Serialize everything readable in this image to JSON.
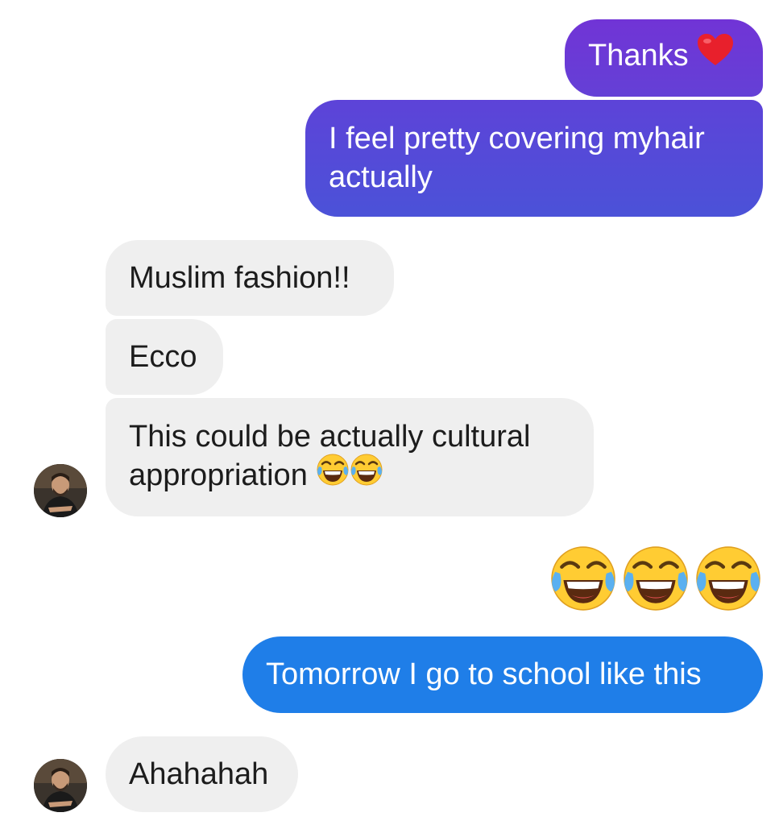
{
  "messages": {
    "m1": {
      "sender": "me",
      "text": "Thanks"
    },
    "m2": {
      "sender": "me",
      "text": "I feel pretty covering myhair actually",
      "line1": "I feel pretty covering myhair",
      "line2": "actually"
    },
    "m3": {
      "sender": "them",
      "text": "Muslim fashion!!"
    },
    "m4": {
      "sender": "them",
      "text": "Ecco"
    },
    "m5": {
      "sender": "them",
      "line1": "This could be actually cultural",
      "line2": "appropriation"
    },
    "m6": {
      "sender": "me",
      "emoji_count": 3,
      "emoji": "tears-of-joy"
    },
    "m7": {
      "sender": "me",
      "text": "Tomorrow I go to school like this"
    },
    "m8": {
      "sender": "them",
      "text": "Ahahahah"
    }
  },
  "colors": {
    "outgoing_gradient_top": "#6a38d6",
    "outgoing_gradient_bottom": "#4a55d8",
    "outgoing_blue": "#1f7ee8",
    "incoming_bg": "#efefef",
    "heart": "#e8202c"
  }
}
